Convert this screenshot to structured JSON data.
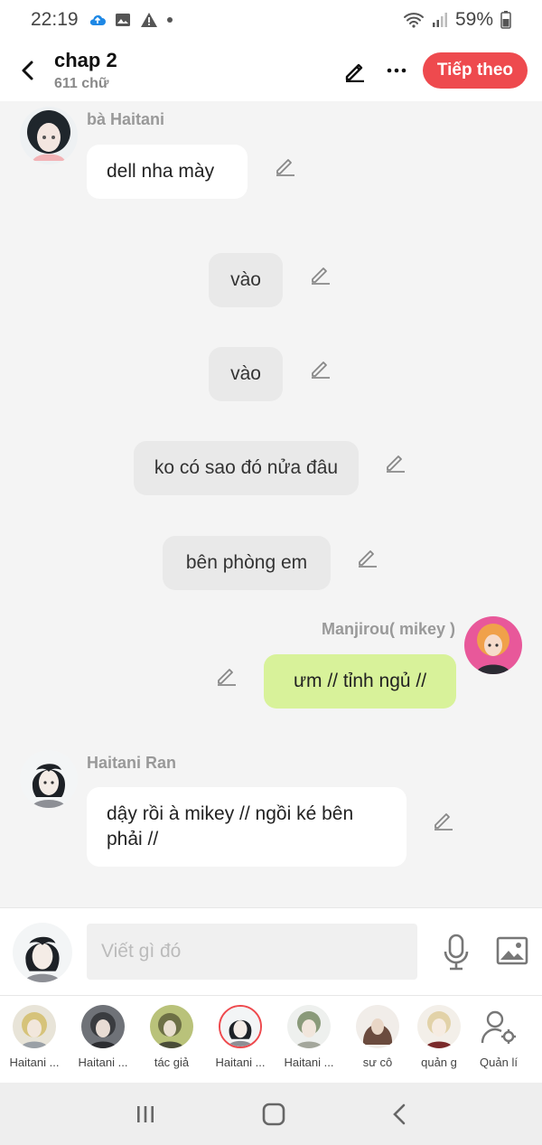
{
  "status_bar": {
    "time": "22:19",
    "battery": "59%"
  },
  "header": {
    "title": "chap 2",
    "subtitle": "611 chữ",
    "next_label": "Tiếp theo"
  },
  "messages": [
    {
      "sender": "bà Haitani",
      "text": "dell nha mày"
    },
    {
      "text": "vào"
    },
    {
      "text": "vào"
    },
    {
      "text": "ko có sao đó nửa đâu"
    },
    {
      "text": "bên phòng em"
    },
    {
      "sender": "Manjirou( mikey )",
      "text": "ưm // tỉnh ngủ //"
    },
    {
      "sender": "Haitani Ran",
      "text": "dậy rồi à mikey // ngồi ké bên phải //"
    }
  ],
  "input": {
    "placeholder": "Viết gì đó"
  },
  "characters": [
    {
      "label": "Haitani ..."
    },
    {
      "label": "Haitani ..."
    },
    {
      "label": "tác giả"
    },
    {
      "label": "Haitani ..."
    },
    {
      "label": "Haitani ..."
    },
    {
      "label": "sư cô"
    },
    {
      "label": "quản g"
    },
    {
      "label": "Quản lí"
    }
  ],
  "colors": {
    "accent": "#ee4a4e",
    "bubble_green": "#d8f29a",
    "bubble_gray": "#e9e9e9"
  }
}
